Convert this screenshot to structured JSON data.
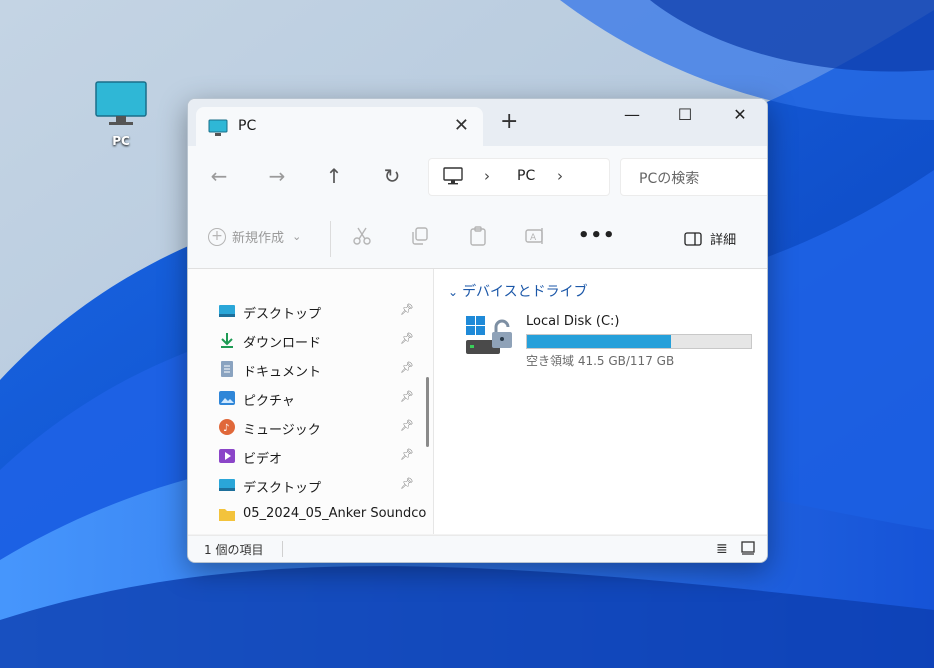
{
  "desktop": {
    "pc_icon_label": "PC"
  },
  "window": {
    "tab_title": "PC",
    "tab_close": "✕",
    "new_tab": "+",
    "minimize": "—",
    "maximize": "☐",
    "close": "✕"
  },
  "nav": {
    "back": "←",
    "forward": "→",
    "up": "↑",
    "refresh": "↻",
    "breadcrumb": [
      "PC"
    ],
    "search_placeholder": "PCの検索"
  },
  "toolbar": {
    "new_label": "新規作成",
    "new_caret": "⌄",
    "more": "•••",
    "details_label": "詳細"
  },
  "sidebar": {
    "items": [
      {
        "label": "デスクトップ",
        "icon": "desktop-icon",
        "pinned": true
      },
      {
        "label": "ダウンロード",
        "icon": "download-icon",
        "pinned": true
      },
      {
        "label": "ドキュメント",
        "icon": "document-icon",
        "pinned": true
      },
      {
        "label": "ピクチャ",
        "icon": "pictures-icon",
        "pinned": true
      },
      {
        "label": "ミュージック",
        "icon": "music-icon",
        "pinned": true
      },
      {
        "label": "ビデオ",
        "icon": "video-icon",
        "pinned": true
      },
      {
        "label": "デスクトップ",
        "icon": "desktop-icon",
        "pinned": true
      },
      {
        "label": "05_2024_05_Anker Soundco",
        "icon": "folder-icon",
        "pinned": false
      }
    ]
  },
  "content": {
    "group_title": "デバイスとドライブ",
    "drive": {
      "name": "Local Disk (C:)",
      "free_text": "空き領域 41.5 GB/117 GB",
      "used_fraction": 0.645
    }
  },
  "status": {
    "item_count": "1 個の項目"
  },
  "colors": {
    "accent": "#26a0da",
    "group_title": "#1b57a8"
  }
}
